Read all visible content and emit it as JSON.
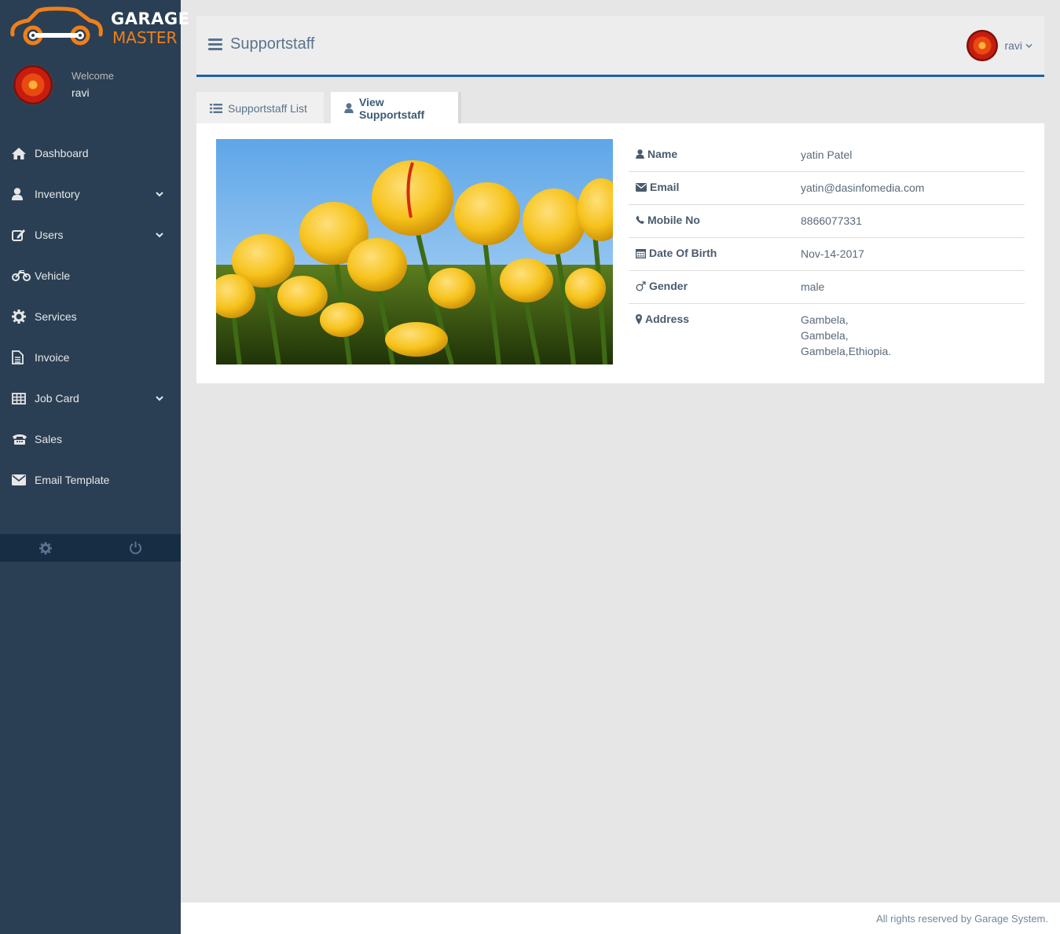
{
  "brand": {
    "line1": "GARAGE",
    "line2": "MASTER",
    "orange": "#f07f1a"
  },
  "profile": {
    "welcome": "Welcome",
    "name": "ravi"
  },
  "sidebar": {
    "items": [
      {
        "label": "Dashboard",
        "icon": "home-icon",
        "has_submenu": false
      },
      {
        "label": "Inventory",
        "icon": "user-icon",
        "has_submenu": true
      },
      {
        "label": "Users",
        "icon": "edit-icon",
        "has_submenu": true
      },
      {
        "label": "Vehicle",
        "icon": "motorcycle-icon",
        "has_submenu": false
      },
      {
        "label": "Services",
        "icon": "cogs-icon",
        "has_submenu": false
      },
      {
        "label": "Invoice",
        "icon": "file-text-icon",
        "has_submenu": false
      },
      {
        "label": "Job Card",
        "icon": "table-icon",
        "has_submenu": true
      },
      {
        "label": "Sales",
        "icon": "phone-icon",
        "has_submenu": false
      },
      {
        "label": "Email Template",
        "icon": "envelope-icon",
        "has_submenu": false
      }
    ],
    "footer_icons": [
      "settings-icon",
      "power-icon"
    ],
    "bg_color": "#2a3f54"
  },
  "header": {
    "title": "Supportstaff",
    "user": "ravi",
    "accent": "#1f5fa8"
  },
  "tabs": [
    {
      "label": "Supportstaff List",
      "icon": "list-icon",
      "active": false
    },
    {
      "label": "View Supportstaff",
      "icon": "user-icon",
      "active": true
    }
  ],
  "details": {
    "name": {
      "label": "Name",
      "value": "yatin Patel",
      "icon": "user-icon"
    },
    "email": {
      "label": "Email",
      "value": "yatin@dasinfomedia.com",
      "icon": "envelope-icon"
    },
    "mobile": {
      "label": "Mobile No",
      "value": "8866077331",
      "icon": "phone-icon"
    },
    "dob": {
      "label": "Date Of Birth",
      "value": "Nov-14-2017",
      "icon": "calendar-icon"
    },
    "gender": {
      "label": "Gender",
      "value": "male",
      "icon": "mars-icon"
    },
    "address": {
      "label": "Address",
      "line1": "Gambela,",
      "line2": "Gambela,",
      "line3": "Gambela,Ethiopia.",
      "icon": "map-marker-icon"
    }
  },
  "footer": {
    "text": "All rights reserved by Garage System."
  }
}
